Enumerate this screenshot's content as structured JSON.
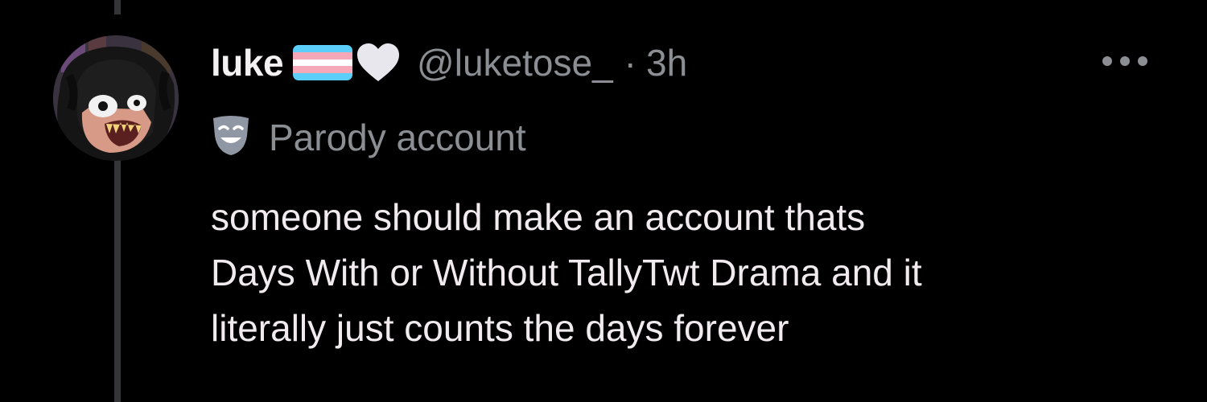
{
  "tweet": {
    "author": {
      "display_name": "luke",
      "handle": "@luketose_",
      "emojis": [
        "transgender-flag",
        "white-heart"
      ]
    },
    "separator": "·",
    "timestamp": "3h",
    "label": {
      "icon": "theater-mask-icon",
      "text": "Parody account"
    },
    "body_lines": [
      "someone should make an account thats",
      "Days With or Without TallyTwt Drama and it",
      "literally just counts the days forever"
    ]
  },
  "colors": {
    "background": "#000000",
    "primary_text": "#e7e9ea",
    "secondary_text": "#8b8f94",
    "thread_line": "#333639"
  }
}
